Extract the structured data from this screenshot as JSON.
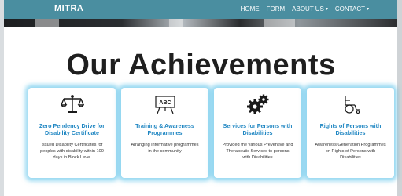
{
  "navbar": {
    "brand": "MITRA",
    "links": [
      {
        "label": "HOME",
        "caret": ""
      },
      {
        "label": "FORM",
        "caret": ""
      },
      {
        "label": "ABOUT US",
        "caret": "▾"
      },
      {
        "label": "CONTACT",
        "caret": "▾"
      }
    ],
    "color": "#4a8ea0"
  },
  "section": {
    "heading": "Our Achievements"
  },
  "cards": [
    {
      "icon": "scales-of-justice-icon",
      "title": "Zero Pendency Drive for Disability Certificate",
      "description": "Issued Disability Certificates for peoples with disability within 100 days in Block Level"
    },
    {
      "icon": "abc-board-icon",
      "title": "Training & Awareness Programmes",
      "description": "Arranging informative programmes in the community"
    },
    {
      "icon": "gears-icon",
      "title": "Services for Persons with Disabilities",
      "description": "Provided the various Preventive and Therapeutic Services to persons with Disabilities"
    },
    {
      "icon": "wheelchair-icon",
      "title": "Rights of Persons with Disabilities",
      "description": "Awareness Generation Programmes on Rights of Persons with Disabilities"
    }
  ],
  "colors": {
    "card_title": "#1f86c2",
    "card_glow": "#40b8e6"
  }
}
